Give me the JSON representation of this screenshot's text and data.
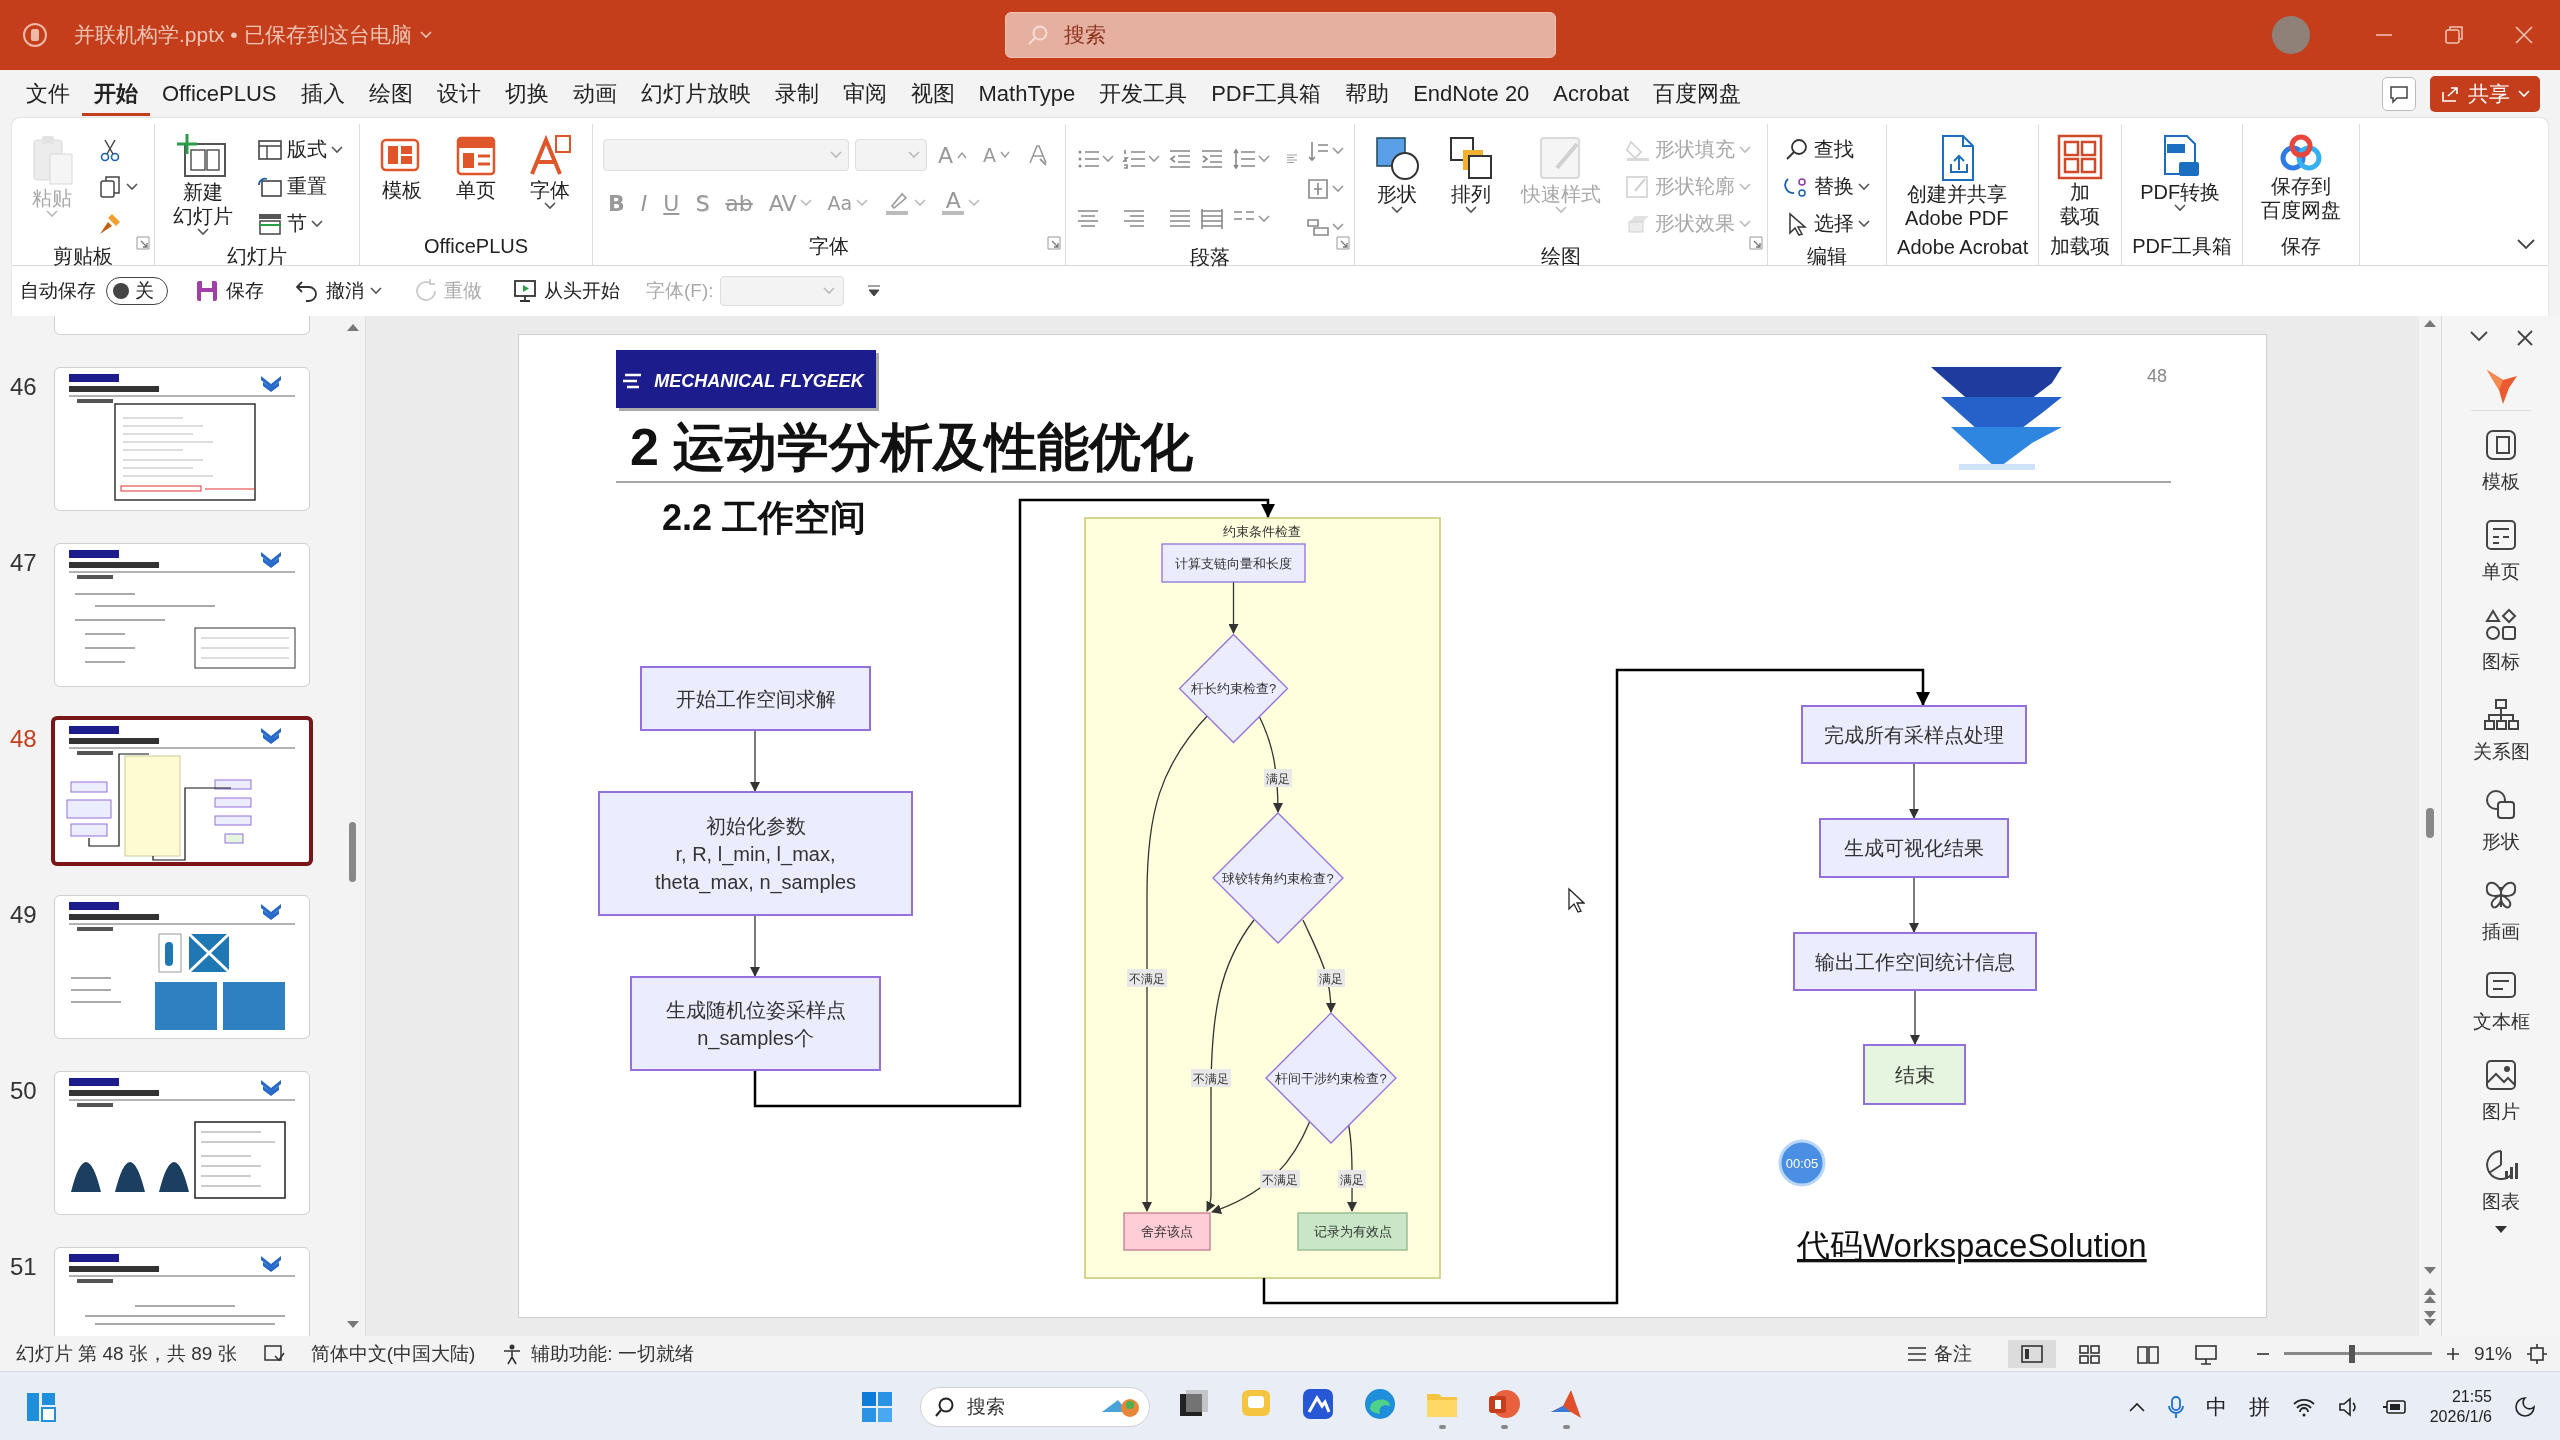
{
  "title_bar": {
    "file_title": "并联机构学.pptx • 已保存到这台电脑",
    "search": {
      "placeholder": "搜索"
    }
  },
  "menu_tabs": [
    {
      "label": "文件",
      "selected": false
    },
    {
      "label": "开始",
      "selected": true
    },
    {
      "label": "OfficePLUS",
      "selected": false
    },
    {
      "label": "插入",
      "selected": false
    },
    {
      "label": "绘图",
      "selected": false
    },
    {
      "label": "设计",
      "selected": false
    },
    {
      "label": "切换",
      "selected": false
    },
    {
      "label": "动画",
      "selected": false
    },
    {
      "label": "幻灯片放映",
      "selected": false
    },
    {
      "label": "录制",
      "selected": false
    },
    {
      "label": "审阅",
      "selected": false
    },
    {
      "label": "视图",
      "selected": false
    },
    {
      "label": "MathType",
      "selected": false
    },
    {
      "label": "开发工具",
      "selected": false
    },
    {
      "label": "PDF工具箱",
      "selected": false
    },
    {
      "label": "帮助",
      "selected": false
    },
    {
      "label": "EndNote 20",
      "selected": false
    },
    {
      "label": "Acrobat",
      "selected": false
    },
    {
      "label": "百度网盘",
      "selected": false
    }
  ],
  "share_button": {
    "label": "共享"
  },
  "ribbon": {
    "groups": [
      {
        "label": "剪贴板",
        "kind": "buttons",
        "launcher": true,
        "items": [
          {
            "kind": "large",
            "label": "粘贴",
            "disabled": true,
            "dropdown": true
          },
          {
            "kind": "icon",
            "disabled": false,
            "dropdown": false
          },
          {
            "kind": "icon",
            "disabled": false,
            "dropdown": true
          },
          {
            "kind": "icon",
            "disabled": false,
            "dropdown": false
          }
        ]
      },
      {
        "label": "幻灯片",
        "kind": "buttons",
        "launcher": false,
        "items": [
          {
            "kind": "large",
            "lines": [
              "新建",
              "幻灯片"
            ],
            "disabled": false,
            "dropdown": true
          },
          {
            "kind": "small",
            "label": "版式",
            "disabled": false,
            "dropdown": true
          },
          {
            "kind": "small",
            "label": "重置",
            "disabled": false,
            "dropdown": false
          },
          {
            "kind": "small",
            "label": "节",
            "disabled": false,
            "dropdown": true
          }
        ]
      },
      {
        "label": "OfficePLUS",
        "kind": "buttons",
        "launcher": false,
        "items": [
          {
            "kind": "large",
            "label": "模板",
            "disabled": false,
            "dropdown": false
          },
          {
            "kind": "large",
            "label": "单页",
            "disabled": false,
            "dropdown": false
          },
          {
            "kind": "large",
            "label": "字体",
            "disabled": false,
            "dropdown": true
          }
        ]
      },
      {
        "label": "字体",
        "kind": "font",
        "launcher": true,
        "rows": [
          [
            {
              "kind": "field",
              "disabled": true,
              "dropdown": true
            },
            {
              "kind": "size-field",
              "disabled": true,
              "dropdown": true
            },
            {
              "kind": "grow",
              "label": "A",
              "disabled": true,
              "dropdown": false
            },
            {
              "kind": "shrink",
              "label": "A",
              "disabled": true,
              "dropdown": false
            },
            {
              "kind": "icon",
              "disabled": true,
              "dropdown": false
            }
          ],
          [
            {
              "kind": "glyph",
              "label": "B",
              "disabled": true,
              "dropdown": false
            },
            {
              "kind": "glyph",
              "label": "I",
              "disabled": true,
              "dropdown": false
            },
            {
              "kind": "glyph",
              "label": "U",
              "disabled": true,
              "dropdown": false
            },
            {
              "kind": "glyph",
              "label": "S",
              "disabled": true,
              "dropdown": false
            },
            {
              "kind": "glyph",
              "label": "ab",
              "disabled": true,
              "dropdown": false
            },
            {
              "kind": "glyph",
              "label": "AV",
              "disabled": true,
              "dropdown": true
            },
            {
              "kind": "glyph",
              "label": "Aa",
              "disabled": true,
              "dropdown": true
            },
            {
              "kind": "icon",
              "disabled": true,
              "dropdown": true
            },
            {
              "kind": "color-glyph",
              "label": "A",
              "disabled": true,
              "dropdown": true
            }
          ]
        ]
      },
      {
        "label": "段落",
        "kind": "paragraph",
        "launcher": true
      },
      {
        "label": "绘图",
        "kind": "buttons",
        "launcher": true,
        "items": [
          {
            "kind": "large",
            "label": "形状",
            "disabled": false,
            "dropdown": true
          },
          {
            "kind": "large",
            "label": "排列",
            "disabled": false,
            "dropdown": true
          },
          {
            "kind": "large",
            "label": "快速样式",
            "disabled": true,
            "dropdown": true
          },
          {
            "kind": "small",
            "label": "形状填充",
            "disabled": true,
            "dropdown": true
          },
          {
            "kind": "small",
            "label": "形状轮廓",
            "disabled": true,
            "dropdown": true
          },
          {
            "kind": "small",
            "label": "形状效果",
            "disabled": true,
            "dropdown": true
          }
        ]
      },
      {
        "label": "编辑",
        "kind": "buttons",
        "launcher": false,
        "items": [
          {
            "kind": "small",
            "label": "查找",
            "disabled": false,
            "dropdown": false
          },
          {
            "kind": "small",
            "label": "替换",
            "disabled": false,
            "dropdown": true
          },
          {
            "kind": "small",
            "label": "选择",
            "disabled": false,
            "dropdown": true
          }
        ]
      },
      {
        "label": "Adobe Acrobat",
        "kind": "buttons",
        "launcher": false,
        "items": [
          {
            "kind": "large",
            "lines": [
              "创建并共享",
              "Adobe PDF"
            ],
            "disabled": false,
            "dropdown": false
          }
        ]
      },
      {
        "label": "加载项",
        "kind": "buttons",
        "launcher": false,
        "items": [
          {
            "kind": "large",
            "lines": [
              "加",
              "载项"
            ],
            "disabled": false,
            "dropdown": false
          }
        ]
      },
      {
        "label": "PDF工具箱",
        "kind": "buttons",
        "launcher": false,
        "items": [
          {
            "kind": "large",
            "label": "PDF转换",
            "disabled": false,
            "dropdown": true
          }
        ]
      },
      {
        "label": "保存",
        "kind": "buttons",
        "launcher": false,
        "items": [
          {
            "kind": "large",
            "lines": [
              "保存到",
              "百度网盘"
            ],
            "disabled": false,
            "dropdown": false
          }
        ]
      }
    ]
  },
  "quick_access": {
    "autosave": {
      "label": "自动保存",
      "on": false,
      "state_label": "关"
    },
    "items": [
      {
        "label": "保存",
        "disabled": false,
        "dropdown": false
      },
      {
        "label": "撤消",
        "disabled": false,
        "dropdown": true
      },
      {
        "label": "重做",
        "disabled": true,
        "dropdown": false
      },
      {
        "label": "从头开始",
        "disabled": false,
        "dropdown": false
      }
    ],
    "font_field": {
      "label": "字体(F):",
      "disabled": true
    }
  },
  "thumbnails": [
    {
      "number": "46",
      "selected": false
    },
    {
      "number": "47",
      "selected": false
    },
    {
      "number": "48",
      "selected": true
    },
    {
      "number": "49",
      "selected": false
    },
    {
      "number": "50",
      "selected": false
    },
    {
      "number": "51",
      "selected": false
    }
  ],
  "slide": {
    "logo_text": "MECHANICAL FLYGEEK",
    "page_number": "48",
    "title": "2 运动学分析及性能优化",
    "subtitle": "2.2 工作空间",
    "flowchart": {
      "subgraph_title": "约束条件检查",
      "nodes": [
        {
          "kind": "process",
          "lines": [
            "开始工作空间求解"
          ]
        },
        {
          "kind": "process",
          "lines": [
            "初始化参数",
            "r, R, l_min, l_max,",
            "theta_max, n_samples"
          ]
        },
        {
          "kind": "process",
          "lines": [
            "生成随机位姿采样点",
            "n_samples个"
          ]
        },
        {
          "kind": "process",
          "lines": [
            "计算支链向量和长度"
          ]
        },
        {
          "kind": "decision",
          "lines": [
            "杆长约束检查?"
          ]
        },
        {
          "kind": "decision",
          "lines": [
            "球铰转角约束检查?"
          ]
        },
        {
          "kind": "decision",
          "lines": [
            "杆间干涉约束检查?"
          ]
        },
        {
          "kind": "discard",
          "lines": [
            "舍弃该点"
          ]
        },
        {
          "kind": "valid",
          "lines": [
            "记录为有效点"
          ]
        },
        {
          "kind": "process",
          "lines": [
            "完成所有采样点处理"
          ]
        },
        {
          "kind": "process",
          "lines": [
            "生成可视化结果"
          ]
        },
        {
          "kind": "process",
          "lines": [
            "输出工作空间统计信息"
          ]
        },
        {
          "kind": "terminal",
          "lines": [
            "结束"
          ]
        }
      ],
      "edge_labels": [
        "满足",
        "不满足",
        "满足",
        "不满足",
        "不满足",
        "满足"
      ]
    },
    "code_note": "代码WorkspaceSolution",
    "recording_timer": "00:05"
  },
  "side_pane": {
    "items": [
      {
        "label": "模板"
      },
      {
        "label": "单页"
      },
      {
        "label": "图标"
      },
      {
        "label": "关系图"
      },
      {
        "label": "形状"
      },
      {
        "label": "插画"
      },
      {
        "label": "文本框"
      },
      {
        "label": "图片"
      },
      {
        "label": "图表"
      }
    ]
  },
  "status_bar": {
    "slide_info": "幻灯片 第 48 张，共 89 张",
    "language": "简体中文(中国大陆)",
    "accessibility": "辅助功能: 一切就绪",
    "notes": "备注",
    "views": [
      {
        "selected": true
      },
      {
        "selected": false
      },
      {
        "selected": false
      },
      {
        "selected": false
      }
    ],
    "zoom": {
      "level": 0.46,
      "reading": "91%"
    }
  },
  "taskbar": {
    "search": {
      "placeholder": "搜索"
    },
    "apps": [
      {
        "running": false
      },
      {
        "running": false
      },
      {
        "running": false
      },
      {
        "running": false
      },
      {
        "running": true
      },
      {
        "running": true
      },
      {
        "running": true
      }
    ],
    "tray": {
      "input_mode": "中",
      "ime": "拼",
      "time": "21:55",
      "date": "2026/1/6"
    }
  }
}
